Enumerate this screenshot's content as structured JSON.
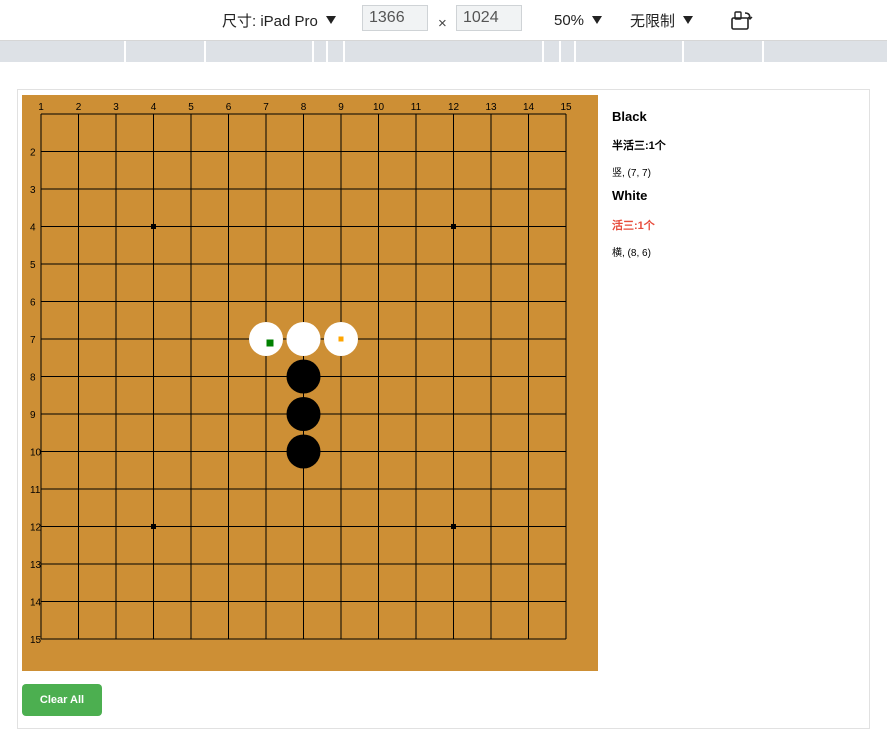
{
  "toolbar": {
    "dimensions_label": "尺寸: iPad Pro",
    "width_value": "1366",
    "height_value": "1024",
    "times": "×",
    "zoom": "50%",
    "throttle": "无限制"
  },
  "board": {
    "size": 15,
    "col_labels": [
      "1",
      "2",
      "3",
      "4",
      "5",
      "6",
      "7",
      "8",
      "9",
      "10",
      "11",
      "12",
      "13",
      "14",
      "15"
    ],
    "row_labels": [
      "2",
      "3",
      "4",
      "5",
      "6",
      "7",
      "8",
      "9",
      "10",
      "11",
      "12",
      "13",
      "14",
      "15"
    ],
    "star_points": [
      [
        4,
        4
      ],
      [
        12,
        4
      ],
      [
        4,
        12
      ],
      [
        12,
        12
      ]
    ],
    "stones": [
      {
        "color": "white",
        "col": 7,
        "row": 7,
        "marker": "green"
      },
      {
        "color": "white",
        "col": 8,
        "row": 7,
        "marker": ""
      },
      {
        "color": "white",
        "col": 9,
        "row": 7,
        "marker": "orange"
      },
      {
        "color": "black",
        "col": 8,
        "row": 8,
        "marker": ""
      },
      {
        "color": "black",
        "col": 8,
        "row": 9,
        "marker": ""
      },
      {
        "color": "black",
        "col": 8,
        "row": 10,
        "marker": ""
      }
    ],
    "colors": {
      "board": "#cd8f35",
      "line": "#000000",
      "marker_green": "#008000",
      "marker_orange": "#ffa500"
    }
  },
  "side": {
    "black_title": "Black",
    "black_status": "半活三:1个",
    "black_detail": "竖, (7, 7)",
    "white_title": "White",
    "white_status": "活三:1个",
    "white_detail": "横, (8, 6)",
    "white_status_color": "#e74c3c"
  },
  "actions": {
    "clear_label": "Clear All"
  }
}
